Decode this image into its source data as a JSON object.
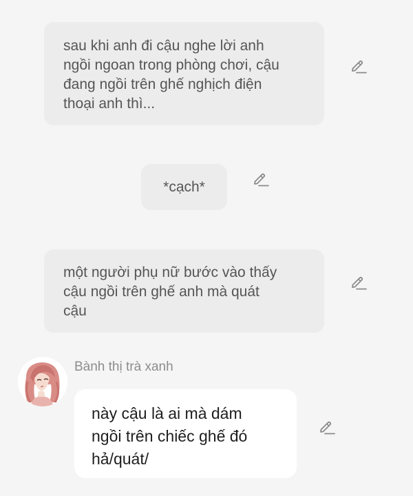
{
  "messages": [
    {
      "kind": "narration",
      "lines": [
        "sau khi anh đi cậu nghe lời anh",
        "ngồi ngoan trong phòng chơi, cậu",
        "đang ngồi trên ghế nghịch điện",
        "thoại anh thì..."
      ]
    },
    {
      "kind": "narration",
      "text": "*cạch*"
    },
    {
      "kind": "narration",
      "lines": [
        "một người phụ nữ bước vào thấy",
        "cậu ngồi trên ghế anh mà quát",
        "cậu"
      ]
    },
    {
      "kind": "character",
      "sender": "Bành thị trà xanh",
      "lines": [
        "này cậu là ai mà dám",
        "ngồi trên chiếc ghế đó",
        "hả/quát/"
      ]
    }
  ],
  "icons": {
    "edit": "pencil-edit-icon",
    "avatar": "character-avatar"
  },
  "colors": {
    "background": "#f5f5f5",
    "narration_bubble": "#ececec",
    "character_bubble": "#ffffff",
    "icon": "#8a8a8a"
  }
}
